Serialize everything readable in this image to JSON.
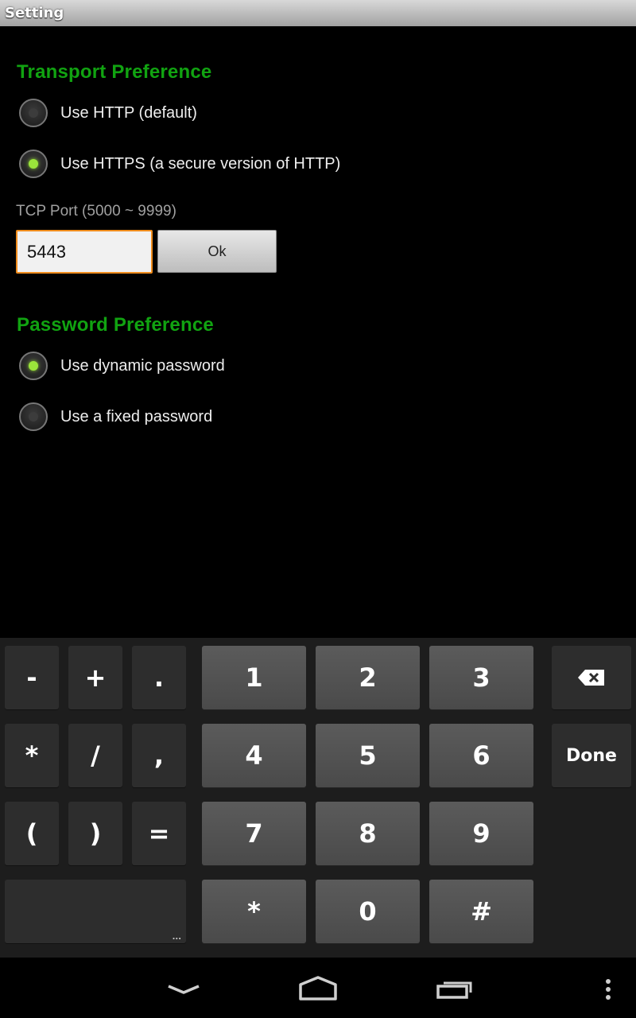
{
  "window": {
    "title": "Setting"
  },
  "transport": {
    "title": "Transport Preference",
    "options": [
      {
        "label": "Use HTTP (default)",
        "selected": false
      },
      {
        "label": "Use HTTPS (a secure version of HTTP)",
        "selected": true
      }
    ],
    "port_hint": "TCP Port (5000 ~ 9999)",
    "port_value": "5443",
    "ok_label": "Ok"
  },
  "password": {
    "title": "Password Preference",
    "options": [
      {
        "label": "Use dynamic password",
        "selected": true
      },
      {
        "label": "Use a fixed password",
        "selected": false
      }
    ]
  },
  "keyboard": {
    "keys": {
      "minus": "-",
      "plus": "+",
      "period": ".",
      "one": "1",
      "two": "2",
      "three": "3",
      "asterisk": "*",
      "slash": "/",
      "comma": ",",
      "four": "4",
      "five": "5",
      "six": "6",
      "lparen": "(",
      "rparen": ")",
      "equals": "=",
      "seven": "7",
      "eight": "8",
      "nine": "9",
      "star": "*",
      "zero": "0",
      "hash": "#",
      "done": "Done",
      "more": "..."
    },
    "icons": {
      "backspace": "backspace-icon"
    }
  },
  "navbar": {
    "icons": [
      "back-icon",
      "home-icon",
      "recents-icon",
      "menu-icon"
    ]
  },
  "colors": {
    "accent": "#11a311",
    "focus_border": "#f08c1c",
    "radio_on": "#9be53b"
  }
}
